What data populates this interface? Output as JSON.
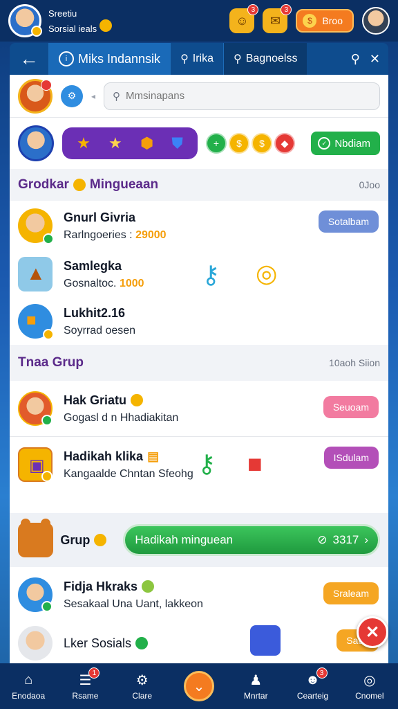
{
  "header": {
    "user_name": "Sreetiu",
    "user_sub": "Sorsial ieals",
    "action_button": "Broo",
    "notif_1": "3",
    "notif_2": "3"
  },
  "tabs": {
    "active_label": "Miks Indannsik",
    "tab2_label": "Irika",
    "tab3_label": "Bagnoelss"
  },
  "search": {
    "placeholder": "Mmsinapans"
  },
  "badge_row": {
    "button_label": "Nbdiam"
  },
  "section1": {
    "title": "Grodkar",
    "title_suffix": "Mingueaan",
    "meta": "0Joo",
    "items": [
      {
        "name": "Gnurl Givria",
        "sub": "Rarlngoeries :",
        "sub_value": "29000",
        "button": "Sotalbam"
      },
      {
        "name": "Samlegka",
        "sub": "Gosnaltoc.",
        "sub_value": "1000"
      },
      {
        "name": "Lukhit2.16",
        "sub": "Soyrrad oesen"
      }
    ]
  },
  "section2": {
    "title": "Tnaa Grup",
    "meta": "10aoh Siion",
    "items": [
      {
        "name": "Hak Griatu",
        "sub": "Gogasl d n Hhadiakitan",
        "button": "Seuoam"
      },
      {
        "name": "Hadikah klika",
        "sub": "Kangaalde Chntan Sfeohg",
        "button": "ISdulam"
      }
    ]
  },
  "grup_row": {
    "label": "Grup",
    "button_label": "Hadikah minguean",
    "count": "3317"
  },
  "section3": {
    "items": [
      {
        "name": "Fidja Hkraks",
        "sub": "Sesakaal Una Uant, lakkeon",
        "button": "Sraleam"
      },
      {
        "name": "Lker Sosials",
        "button": "Sauo"
      }
    ]
  },
  "bottom_nav": {
    "items": [
      {
        "label": "Enodaoa"
      },
      {
        "label": "Rsame",
        "badge": "1"
      },
      {
        "label": "Clare"
      },
      {
        "label": ""
      },
      {
        "label": "Mnrtar"
      },
      {
        "label": "Cearteig",
        "badge": "3"
      },
      {
        "label": "Cnomel"
      }
    ]
  },
  "colors": {
    "header_bg": "#0b2f63",
    "accent_orange": "#f47b20",
    "accent_green": "#22b04a",
    "section_title": "#5b2a8a",
    "badge_purple": "#6b2fb5"
  }
}
